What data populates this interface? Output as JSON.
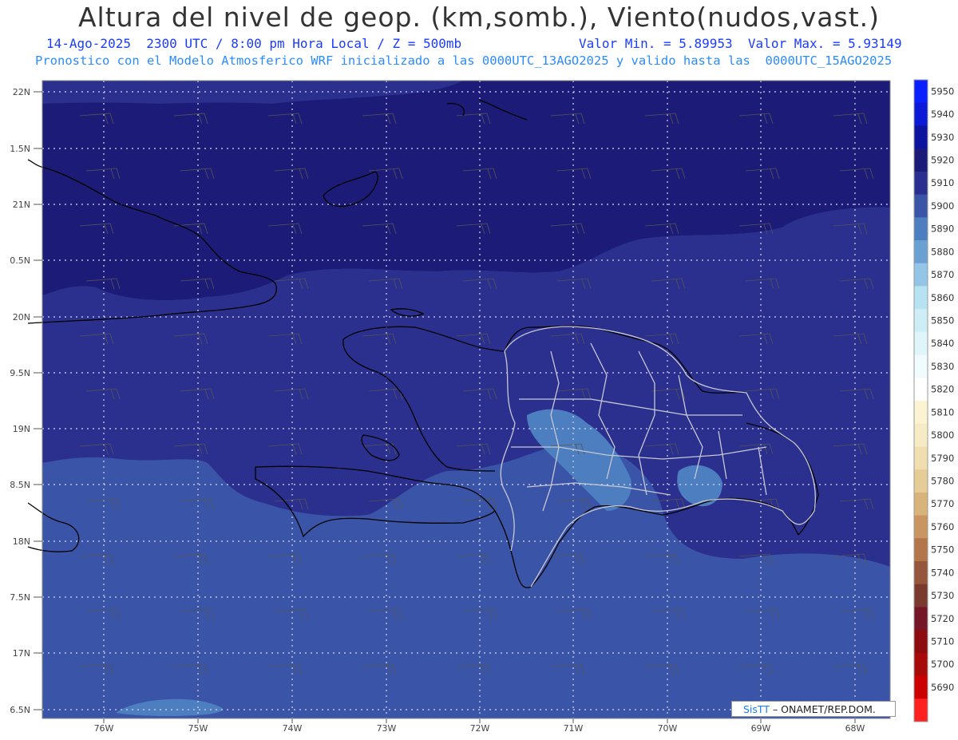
{
  "header": {
    "title": "Altura del nivel de geop. (km,somb.), Viento(nudos,vast.)",
    "line1_left": "14-Ago-2025  2300 UTC / 8:00 pm Hora Local / Z = 500mb",
    "line1_right": "Valor Min. = 5.89953  Valor Max. = 5.93149",
    "line2": "Pronostico con el Modelo Atmosferico WRF inicializado a las 0000UTC_13AGO2025 y valido hasta las  0000UTC_15AGO2025"
  },
  "axes": {
    "lat_labels": [
      "22N",
      "1.5N",
      "21N",
      "0.5N",
      "20N",
      "9.5N",
      "19N",
      "8.5N",
      "18N",
      "7.5N",
      "17N",
      "6.5N"
    ],
    "lon_labels": [
      "76W",
      "75W",
      "74W",
      "73W",
      "72W",
      "71W",
      "70W",
      "69W",
      "68W"
    ]
  },
  "colorbar": {
    "levels": [
      "5950",
      "5940",
      "5930",
      "5920",
      "5910",
      "5900",
      "5890",
      "5880",
      "5870",
      "5860",
      "5850",
      "5840",
      "5830",
      "5820",
      "5810",
      "5800",
      "5790",
      "5780",
      "5770",
      "5760",
      "5750",
      "5740",
      "5730",
      "5720",
      "5710",
      "5700",
      "5690"
    ],
    "colors": [
      "#0a1fff",
      "#0c19d6",
      "#0b139f",
      "#1a1a78",
      "#2a2e8f",
      "#3a55a8",
      "#4d7fc0",
      "#6aa1d2",
      "#93c5e6",
      "#b7e2f1",
      "#cdeef6",
      "#def6fa",
      "#f0fbfd",
      "#ffffff",
      "#fbf3d2",
      "#f7ebc6",
      "#f0deb0",
      "#e6cd98",
      "#d9b47a",
      "#c99560",
      "#b3764b",
      "#96563b",
      "#7a3a2e",
      "#741626",
      "#8c0c10",
      "#a80a0a",
      "#cc0000",
      "#ff2020"
    ]
  },
  "map_colors": {
    "north_dark": "#1c1c78",
    "mid": "#2b2f8e",
    "south": "#3a55a8",
    "light_patch": "#4d7fc0"
  },
  "credit": {
    "brand": "SisTT",
    "text": " – ONAMET/REP.DOM."
  }
}
